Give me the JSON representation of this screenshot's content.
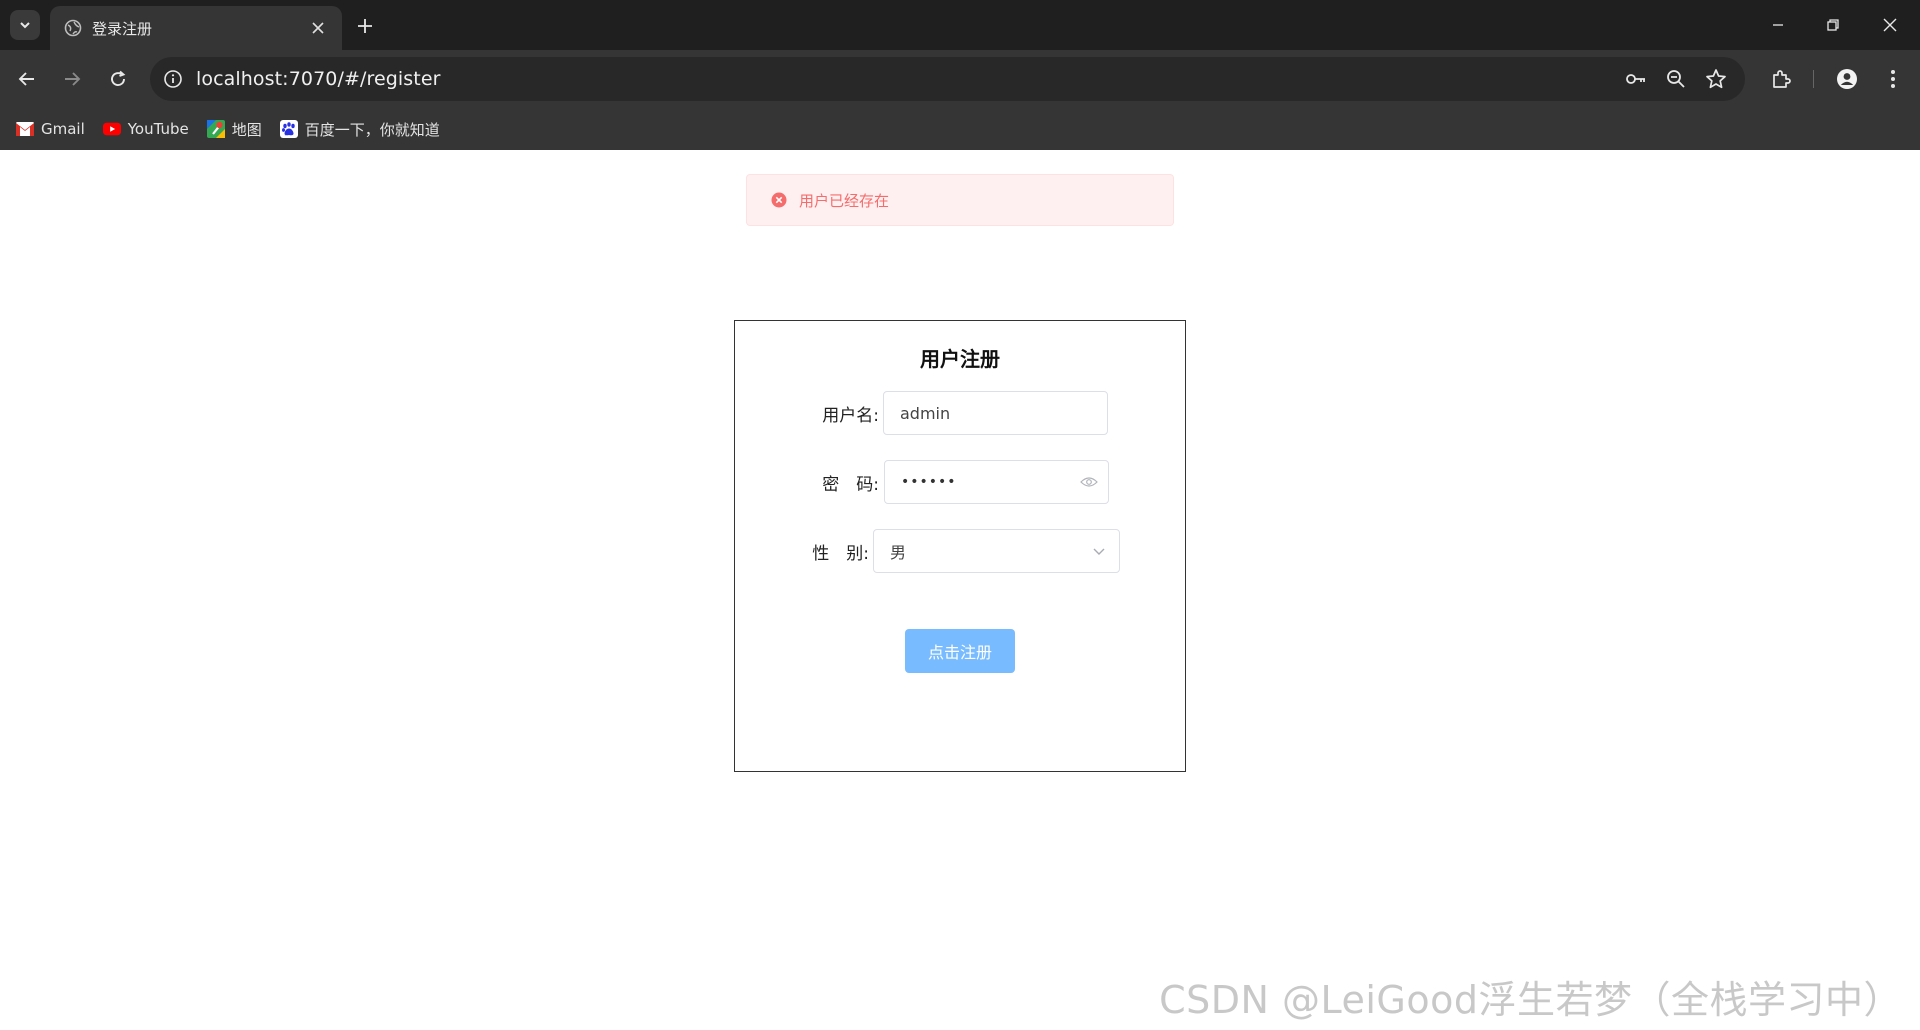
{
  "browser": {
    "tab": {
      "title": "登录注册"
    },
    "address_bar": {
      "url": "localhost:7070/#/register"
    },
    "bookmarks": [
      {
        "label": "Gmail",
        "icon": "gmail-icon"
      },
      {
        "label": "YouTube",
        "icon": "youtube-icon"
      },
      {
        "label": "地图",
        "icon": "maps-icon"
      },
      {
        "label": "百度一下，你就知道",
        "icon": "baidu-icon"
      }
    ]
  },
  "alert": {
    "type": "error",
    "message": "用户已经存在",
    "color": "#f56c6c"
  },
  "register_form": {
    "title": "用户注册",
    "username": {
      "label": "用户名:",
      "value": "admin"
    },
    "password": {
      "label": "密　码:",
      "masked_value": "••••••"
    },
    "gender": {
      "label": "性　别:",
      "selected": "男"
    },
    "submit_label": "点击注册",
    "submit_color": "#79bbff"
  },
  "watermark": "CSDN @LeiGood浮生若梦（全栈学习中）"
}
